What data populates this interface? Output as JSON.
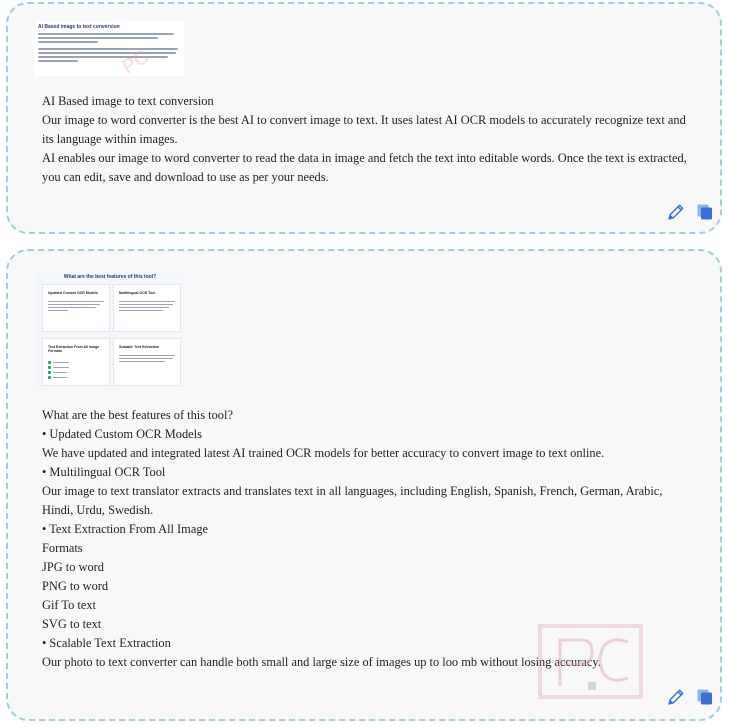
{
  "card1": {
    "thumbnail": {
      "heading": "AI Based image to text conversion",
      "watermark": "PC"
    },
    "lines": [
      "AI Based image to text conversion",
      "Our image to word converter is the best AI to convert image to text. It uses latest AI OCR models to accurately recognize text and its language within images.",
      "AI enables our image to word converter to read the data in image and fetch the text into editable words. Once the text is extracted, you can edit, save and download to use as per your needs."
    ]
  },
  "card2": {
    "thumbnail": {
      "heading": "What are the best features of this tool?",
      "boxes": [
        "Updated Custom OCR Models",
        "Multilingual OCR Tool",
        "Text Extraction From All Image Formats",
        "Scalable Text Extraction"
      ]
    },
    "lines": [
      "What are the best features of this tool?",
      "• Updated Custom OCR Models",
      "We have updated and integrated latest AI trained OCR models for better accuracy to convert image to text online.",
      "• Multilingual OCR Tool",
      "Our image to text translator extracts and translates text in all languages, including English, Spanish, French, German, Arabic, Hindi, Urdu, Swedish.",
      "• Text Extraction From All Image",
      "Formats",
      "JPG to word",
      "PNG to word",
      "Gif To text",
      "SVG to text",
      "• Scalable Text Extraction",
      "Our photo to text converter can handle both small and large size of images up to loo mb without losing accuracy."
    ],
    "watermark": "PC"
  },
  "icons": {
    "edit": "pencil-icon",
    "copy": "copy-icon"
  },
  "colors": {
    "card_border": "#9ecfe0",
    "icon_blue": "#3b6fd6"
  }
}
